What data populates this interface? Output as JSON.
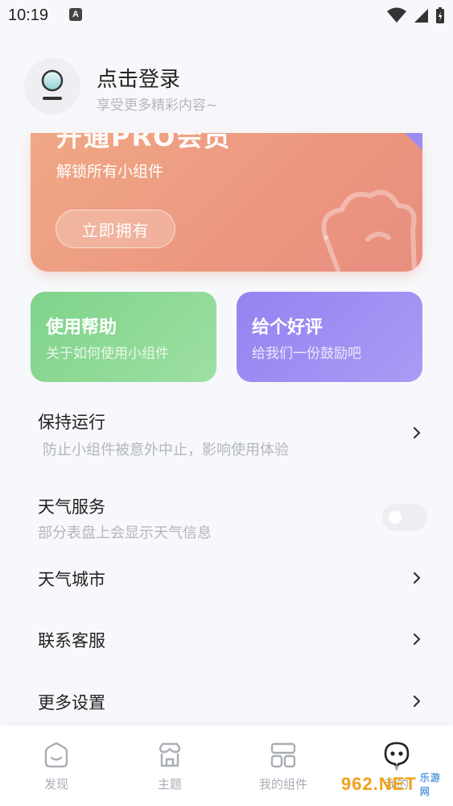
{
  "status": {
    "time": "10:19",
    "a_label": "A"
  },
  "profile": {
    "title": "点击登录",
    "subtitle": "享受更多精彩内容~"
  },
  "pro_card": {
    "title": "开通PRO会员",
    "subtitle": "解锁所有小组件",
    "button": "立即拥有"
  },
  "quick": {
    "help": {
      "title": "使用帮助",
      "subtitle": "关于如何使用小组件"
    },
    "rate": {
      "title": "给个好评",
      "subtitle": "给我们一份鼓励吧"
    }
  },
  "settings": [
    {
      "title": "保持运行",
      "subtitle": "防止小组件被意外中止，影响使用体验",
      "control": "chevron"
    },
    {
      "title": "天气服务",
      "subtitle": "部分表盘上会显示天气信息",
      "control": "toggle",
      "enabled": false
    },
    {
      "title": "天气城市",
      "control": "chevron"
    },
    {
      "title": "联系客服",
      "control": "chevron"
    },
    {
      "title": "更多设置",
      "control": "chevron"
    }
  ],
  "tabs": [
    {
      "label": "发现",
      "icon": "discover-icon"
    },
    {
      "label": "主题",
      "icon": "store-icon"
    },
    {
      "label": "我的组件",
      "icon": "widgets-icon"
    },
    {
      "label": "我的",
      "icon": "profile-face-icon",
      "active": true
    }
  ],
  "watermark": {
    "text": "962.NET",
    "sub": "乐游网"
  },
  "colors": {
    "pro_card": "#ec9880",
    "help_card": "#7fd38a",
    "rate_card": "#9383f0",
    "muted_text": "#b3b6bd"
  }
}
